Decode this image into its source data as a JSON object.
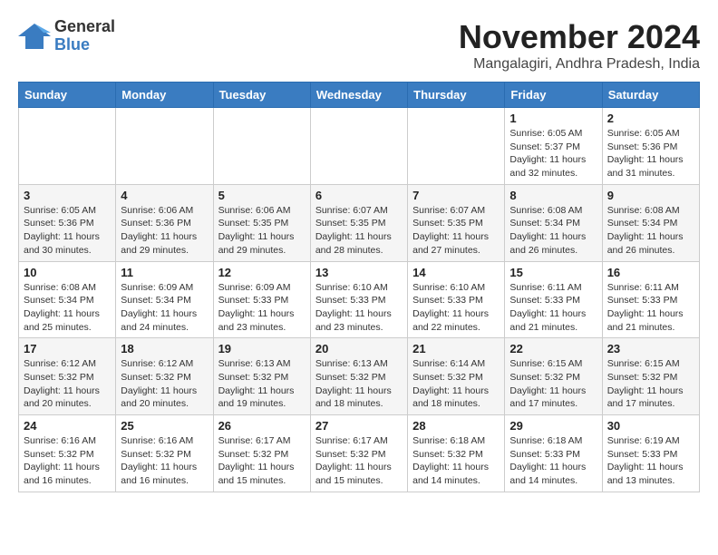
{
  "header": {
    "logo_line1": "General",
    "logo_line2": "Blue",
    "month": "November 2024",
    "location": "Mangalagiri, Andhra Pradesh, India"
  },
  "weekdays": [
    "Sunday",
    "Monday",
    "Tuesday",
    "Wednesday",
    "Thursday",
    "Friday",
    "Saturday"
  ],
  "weeks": [
    [
      {
        "day": "",
        "info": ""
      },
      {
        "day": "",
        "info": ""
      },
      {
        "day": "",
        "info": ""
      },
      {
        "day": "",
        "info": ""
      },
      {
        "day": "",
        "info": ""
      },
      {
        "day": "1",
        "info": "Sunrise: 6:05 AM\nSunset: 5:37 PM\nDaylight: 11 hours and 32 minutes."
      },
      {
        "day": "2",
        "info": "Sunrise: 6:05 AM\nSunset: 5:36 PM\nDaylight: 11 hours and 31 minutes."
      }
    ],
    [
      {
        "day": "3",
        "info": "Sunrise: 6:05 AM\nSunset: 5:36 PM\nDaylight: 11 hours and 30 minutes."
      },
      {
        "day": "4",
        "info": "Sunrise: 6:06 AM\nSunset: 5:36 PM\nDaylight: 11 hours and 29 minutes."
      },
      {
        "day": "5",
        "info": "Sunrise: 6:06 AM\nSunset: 5:35 PM\nDaylight: 11 hours and 29 minutes."
      },
      {
        "day": "6",
        "info": "Sunrise: 6:07 AM\nSunset: 5:35 PM\nDaylight: 11 hours and 28 minutes."
      },
      {
        "day": "7",
        "info": "Sunrise: 6:07 AM\nSunset: 5:35 PM\nDaylight: 11 hours and 27 minutes."
      },
      {
        "day": "8",
        "info": "Sunrise: 6:08 AM\nSunset: 5:34 PM\nDaylight: 11 hours and 26 minutes."
      },
      {
        "day": "9",
        "info": "Sunrise: 6:08 AM\nSunset: 5:34 PM\nDaylight: 11 hours and 26 minutes."
      }
    ],
    [
      {
        "day": "10",
        "info": "Sunrise: 6:08 AM\nSunset: 5:34 PM\nDaylight: 11 hours and 25 minutes."
      },
      {
        "day": "11",
        "info": "Sunrise: 6:09 AM\nSunset: 5:34 PM\nDaylight: 11 hours and 24 minutes."
      },
      {
        "day": "12",
        "info": "Sunrise: 6:09 AM\nSunset: 5:33 PM\nDaylight: 11 hours and 23 minutes."
      },
      {
        "day": "13",
        "info": "Sunrise: 6:10 AM\nSunset: 5:33 PM\nDaylight: 11 hours and 23 minutes."
      },
      {
        "day": "14",
        "info": "Sunrise: 6:10 AM\nSunset: 5:33 PM\nDaylight: 11 hours and 22 minutes."
      },
      {
        "day": "15",
        "info": "Sunrise: 6:11 AM\nSunset: 5:33 PM\nDaylight: 11 hours and 21 minutes."
      },
      {
        "day": "16",
        "info": "Sunrise: 6:11 AM\nSunset: 5:33 PM\nDaylight: 11 hours and 21 minutes."
      }
    ],
    [
      {
        "day": "17",
        "info": "Sunrise: 6:12 AM\nSunset: 5:32 PM\nDaylight: 11 hours and 20 minutes."
      },
      {
        "day": "18",
        "info": "Sunrise: 6:12 AM\nSunset: 5:32 PM\nDaylight: 11 hours and 20 minutes."
      },
      {
        "day": "19",
        "info": "Sunrise: 6:13 AM\nSunset: 5:32 PM\nDaylight: 11 hours and 19 minutes."
      },
      {
        "day": "20",
        "info": "Sunrise: 6:13 AM\nSunset: 5:32 PM\nDaylight: 11 hours and 18 minutes."
      },
      {
        "day": "21",
        "info": "Sunrise: 6:14 AM\nSunset: 5:32 PM\nDaylight: 11 hours and 18 minutes."
      },
      {
        "day": "22",
        "info": "Sunrise: 6:15 AM\nSunset: 5:32 PM\nDaylight: 11 hours and 17 minutes."
      },
      {
        "day": "23",
        "info": "Sunrise: 6:15 AM\nSunset: 5:32 PM\nDaylight: 11 hours and 17 minutes."
      }
    ],
    [
      {
        "day": "24",
        "info": "Sunrise: 6:16 AM\nSunset: 5:32 PM\nDaylight: 11 hours and 16 minutes."
      },
      {
        "day": "25",
        "info": "Sunrise: 6:16 AM\nSunset: 5:32 PM\nDaylight: 11 hours and 16 minutes."
      },
      {
        "day": "26",
        "info": "Sunrise: 6:17 AM\nSunset: 5:32 PM\nDaylight: 11 hours and 15 minutes."
      },
      {
        "day": "27",
        "info": "Sunrise: 6:17 AM\nSunset: 5:32 PM\nDaylight: 11 hours and 15 minutes."
      },
      {
        "day": "28",
        "info": "Sunrise: 6:18 AM\nSunset: 5:32 PM\nDaylight: 11 hours and 14 minutes."
      },
      {
        "day": "29",
        "info": "Sunrise: 6:18 AM\nSunset: 5:33 PM\nDaylight: 11 hours and 14 minutes."
      },
      {
        "day": "30",
        "info": "Sunrise: 6:19 AM\nSunset: 5:33 PM\nDaylight: 11 hours and 13 minutes."
      }
    ]
  ]
}
